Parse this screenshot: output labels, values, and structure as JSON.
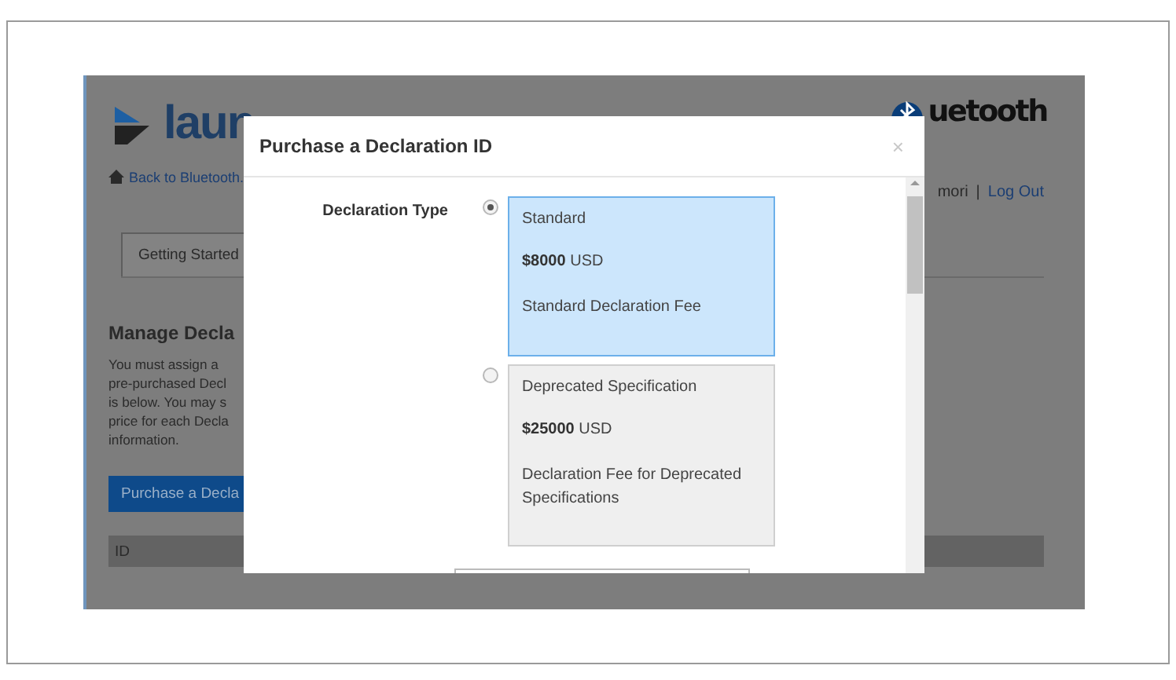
{
  "page": {
    "logo_text": "laun",
    "brand_text": "uetooth",
    "back_link": "Back to Bluetooth.",
    "user_text": "mori",
    "separator": "|",
    "logout_link": "Log Out",
    "tabs": [
      {
        "label": "Getting Started",
        "selected": true
      }
    ],
    "heading": "Manage Decla",
    "paragraph_lines": [
      "You must assign a",
      "pre-purchased Decl",
      "is below. You may s",
      "price for each Decla",
      "information."
    ],
    "purchase_button": "Purchase a Decla",
    "table_header": [
      "ID"
    ]
  },
  "modal": {
    "title": "Purchase a Declaration ID",
    "close": "×",
    "field_label": "Declaration Type",
    "options": [
      {
        "selected": true,
        "name": "Standard",
        "price": "$8000",
        "currency": "USD",
        "description": "Standard Declaration Fee"
      },
      {
        "selected": false,
        "name": "Deprecated Specification",
        "price": "$25000",
        "currency": "USD",
        "description": "Declaration Fee for Deprecated Specifications"
      }
    ]
  }
}
